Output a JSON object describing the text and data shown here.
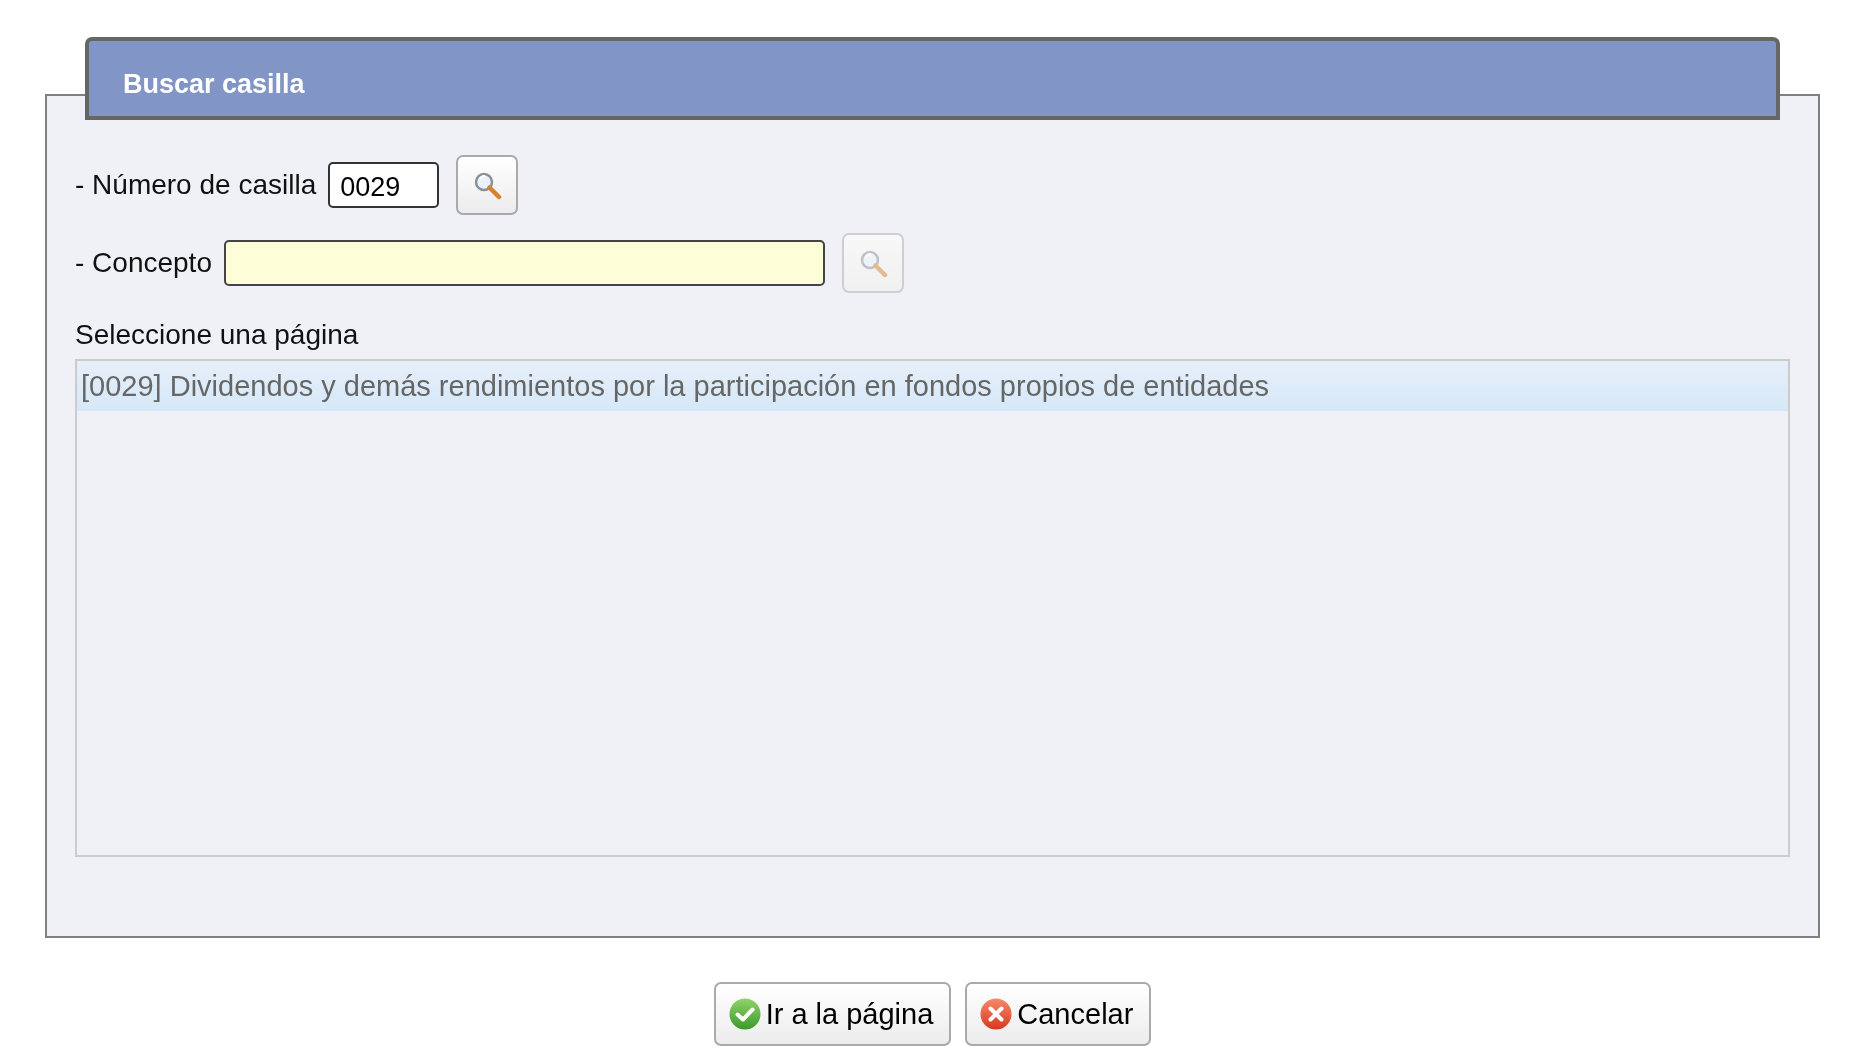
{
  "window": {
    "title": "Buscar casilla"
  },
  "fields": [
    {
      "kind": "number",
      "label": "- Número de casilla",
      "value": "0029",
      "highlighted": false,
      "search_disabled": false
    },
    {
      "kind": "text",
      "label": "- Concepto",
      "highlighted": true,
      "search_disabled": true
    }
  ],
  "list": {
    "label": "Seleccione una página",
    "items": [
      {
        "text": "[0029] Dividendos y demás rendimientos por la participación en fondos propios de entidades",
        "selected": true
      }
    ]
  },
  "buttons": [
    {
      "kind": "confirm",
      "label": "Ir a la página"
    },
    {
      "kind": "cancel",
      "label": "Cancelar"
    }
  ]
}
